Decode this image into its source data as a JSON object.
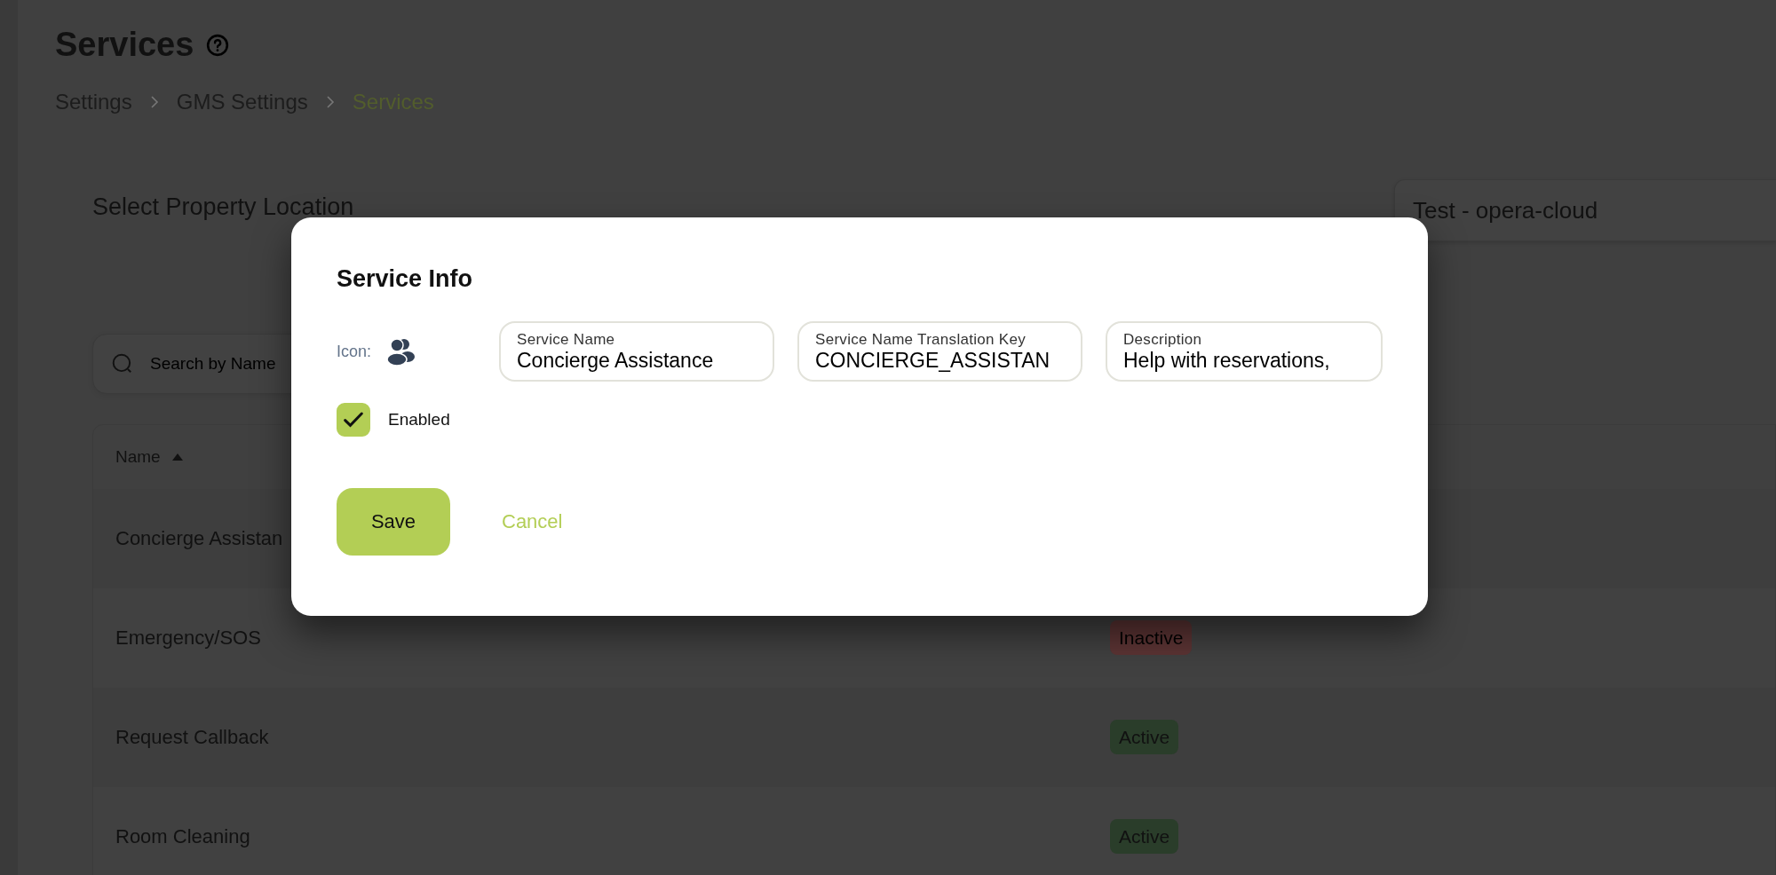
{
  "page": {
    "title": "Services"
  },
  "breadcrumb": [
    {
      "label": "Settings",
      "current": false
    },
    {
      "label": "GMS Settings",
      "current": false
    },
    {
      "label": "Services",
      "current": true
    }
  ],
  "property": {
    "label": "Select Property Location",
    "value": "Test - opera-cloud"
  },
  "search": {
    "placeholder": "Search by Name"
  },
  "table": {
    "columns": [
      {
        "label": "Name",
        "sorted_ascending": true
      }
    ],
    "rows": [
      {
        "name": "Concierge Assistan"
      },
      {
        "name": "Emergency/SOS",
        "status": {
          "label": "Inactive",
          "kind": "inactive"
        }
      },
      {
        "name": "Request Callback",
        "status": {
          "label": "Active",
          "kind": "active"
        }
      },
      {
        "name": "Room Cleaning",
        "status": {
          "label": "Active",
          "kind": "active"
        }
      }
    ]
  },
  "dialog": {
    "title": "Service Info",
    "icon_label": "Icon:",
    "fields": [
      {
        "label": "Service Name",
        "value": "Concierge Assistance"
      },
      {
        "label": "Service Name Translation Key",
        "value": "CONCIERGE_ASSISTAN"
      },
      {
        "label": "Description",
        "value": "Help with reservations,"
      }
    ],
    "enabled": {
      "label": "Enabled",
      "checked": true
    },
    "buttons": [
      {
        "label": "Save",
        "kind": "primary"
      },
      {
        "label": "Cancel",
        "kind": "link"
      }
    ]
  }
}
